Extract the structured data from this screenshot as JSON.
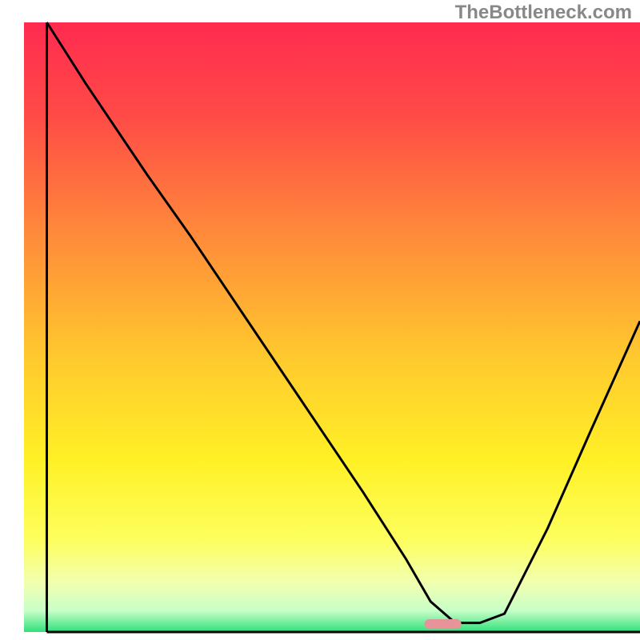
{
  "watermark": "TheBottleneck.com",
  "chart_data": {
    "type": "line",
    "title": "",
    "xlabel": "",
    "ylabel": "",
    "xlim": [
      0,
      100
    ],
    "ylim": [
      0,
      100
    ],
    "background_gradient": {
      "stops": [
        {
          "offset": 0.0,
          "color": "#ff2b4f"
        },
        {
          "offset": 0.15,
          "color": "#ff4a47"
        },
        {
          "offset": 0.35,
          "color": "#ff8b3a"
        },
        {
          "offset": 0.55,
          "color": "#ffc92e"
        },
        {
          "offset": 0.72,
          "color": "#fff126"
        },
        {
          "offset": 0.85,
          "color": "#fdff5f"
        },
        {
          "offset": 0.92,
          "color": "#f1ffb0"
        },
        {
          "offset": 0.965,
          "color": "#c8ffc8"
        },
        {
          "offset": 1.0,
          "color": "#2fe07a"
        }
      ]
    },
    "series": [
      {
        "name": "bottleneck-curve",
        "color": "#000000",
        "x": [
          3.7,
          10,
          20,
          27,
          35,
          45,
          55,
          62,
          66,
          70,
          74,
          78,
          85,
          92,
          100
        ],
        "y": [
          100,
          90,
          75,
          65,
          53,
          38,
          23,
          12,
          5,
          1.5,
          1.5,
          3,
          17,
          33,
          51
        ]
      }
    ],
    "marker": {
      "name": "sweet-spot",
      "color": "#e6939a",
      "x_center": 68,
      "width": 6,
      "y": 1.3,
      "height": 1.6
    },
    "axes": {
      "left": {
        "x": 3.7,
        "y0": 0,
        "y1": 100
      },
      "bottom": {
        "y": 0,
        "x0": 3.7,
        "x1": 100
      }
    }
  }
}
